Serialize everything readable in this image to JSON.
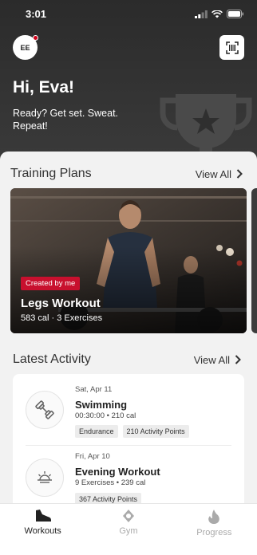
{
  "status_bar": {
    "time": "3:01"
  },
  "header": {
    "avatar_initials": "EE",
    "greeting": "Hi, Eva!",
    "tagline": "Ready? Get set. Sweat. Repeat!"
  },
  "training_plans": {
    "title": "Training Plans",
    "view_all": "View All",
    "cards": [
      {
        "badge": "Created by me",
        "title": "Legs Workout",
        "meta": "583 cal · 3 Exercises"
      }
    ]
  },
  "latest_activity": {
    "title": "Latest Activity",
    "view_all": "View All",
    "items": [
      {
        "date": "Sat, Apr 11",
        "title": "Swimming",
        "meta": "00:30:00 • 210 cal",
        "tags": [
          "Endurance",
          "210 Activity Points"
        ],
        "icon": "swimming-dumbbell-icon"
      },
      {
        "date": "Fri, Apr 10",
        "title": "Evening Workout",
        "meta": "9 Exercises • 239 cal",
        "tags": [
          "367 Activity Points"
        ],
        "icon": "sunset-icon"
      }
    ]
  },
  "tabs": [
    {
      "label": "Workouts",
      "icon": "shoe-icon",
      "active": true
    },
    {
      "label": "Gym",
      "icon": "location-icon",
      "active": false
    },
    {
      "label": "Progress",
      "icon": "flame-icon",
      "active": false
    }
  ],
  "colors": {
    "accent": "#c8102e",
    "hero_bg": "#2f2f2f",
    "active_tab": "#222222",
    "inactive_tab": "#aaaaaa"
  }
}
